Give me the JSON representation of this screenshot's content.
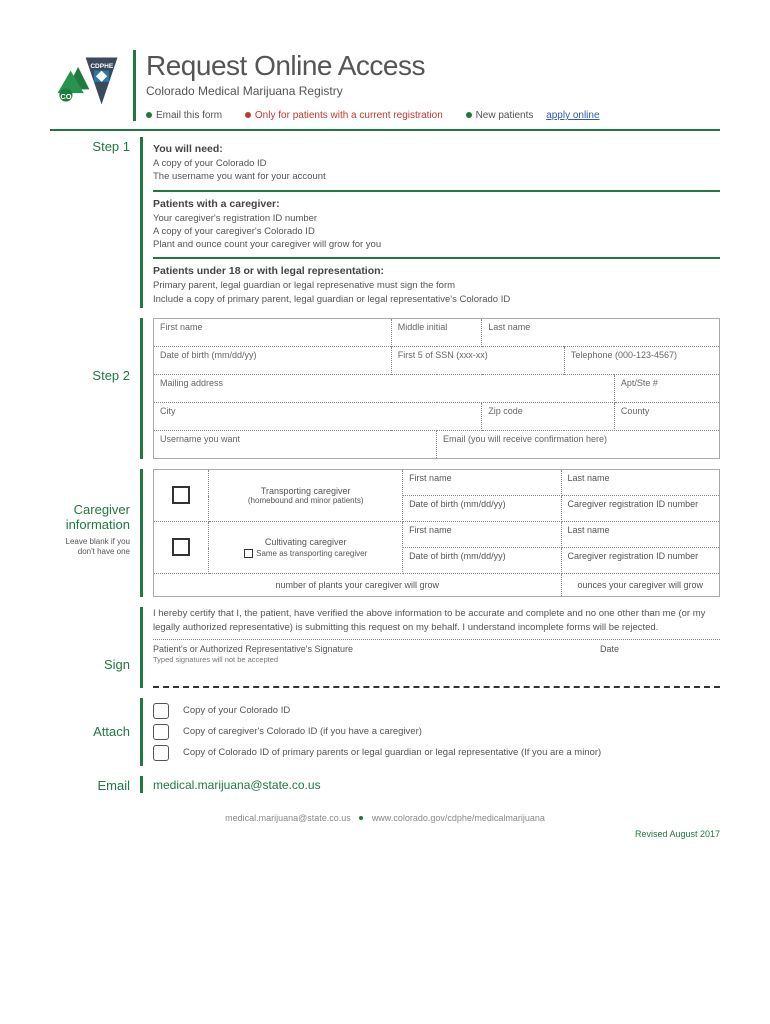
{
  "header": {
    "title": "Request Online Access",
    "subtitle": "Colorado Medical Marijuana Registry",
    "bullet1": "Email this form",
    "bullet2": "Only for patients with a current registration",
    "bullet3": "New patients ",
    "bullet3_link": "apply online"
  },
  "step1": {
    "label": "Step 1",
    "need_h": "You will need:",
    "need_l1": "A copy of your Colorado ID",
    "need_l2": "The username you want for your account",
    "cg_h": "Patients with a caregiver:",
    "cg_l1": "Your caregiver's registration ID number",
    "cg_l2": "A copy of your caregiver's Colorado ID",
    "cg_l3": "Plant and ounce count your caregiver will grow for you",
    "minor_h": "Patients under 18 or with legal representation:",
    "minor_l1": "Primary parent, legal guardian  or legal represenative must sign the form",
    "minor_l2": "Include a copy of primary parent, legal guardian or legal representative's Colorado ID"
  },
  "step2": {
    "label": "Step 2",
    "f_first": "First name",
    "f_mi": "Middle initial",
    "f_last": "Last name",
    "f_dob": "Date of birth (mm/dd/yy)",
    "f_ssn": "First 5 of SSN (xxx-xx)",
    "f_tel": "Telephone (000-123-4567)",
    "f_mail": "Mailing address",
    "f_apt": "Apt/Ste #",
    "f_city": "City",
    "f_zip": "Zip code",
    "f_county": "County",
    "f_user": "Username you want",
    "f_email": "Email (you will receive confirmation here)"
  },
  "caregiver": {
    "label": "Caregiver information",
    "sub": "Leave blank if you don't have one",
    "transporting": "Transporting caregiver",
    "transporting_sub": "(homebound and minor patients)",
    "cultivating": "Cultivating caregiver",
    "same_as": "Same as transporting caregiver",
    "f_first": "First name",
    "f_last": "Last name",
    "f_dob": "Date of birth (mm/dd/yy)",
    "f_reg": "Caregiver registration ID number",
    "plants": "number of plants your caregiver will grow",
    "ounces": "ounces your caregiver will grow"
  },
  "sign": {
    "label": "Sign",
    "certify": "I hereby certify that I, the patient, have verified the above information to be accurate and complete and no one other than me (or my legally authorized representative) is submitting this request on my behalf. I understand incomplete forms will be rejected.",
    "sig_label": "Patient's or Authorized Representative's Signature",
    "sig_note": "Typed signatures will not be accepted",
    "date_label": "Date"
  },
  "attach": {
    "label": "Attach",
    "a1": "Copy of your Colorado ID",
    "a2": "Copy of caregiver's Colorado ID (if you have a caregiver)",
    "a3": "Copy of Colorado ID of primary parents or legal guardian or legal representative (If you are a minor)"
  },
  "email": {
    "label": "Email",
    "address": "medical.marijuana@state.co.us"
  },
  "footer": {
    "email": "medical.marijuana@state.co.us",
    "url": "www.colorado.gov/cdphe/medicalmarijuana",
    "revised": "Revised August 2017"
  }
}
